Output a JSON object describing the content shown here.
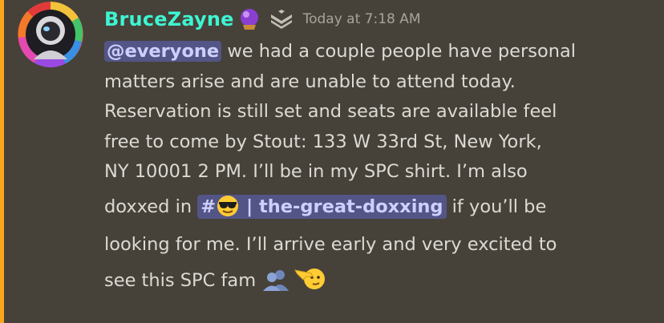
{
  "colors": {
    "background": "#46423a",
    "mention_accent": "#faa61a",
    "username": "#3ef5d2",
    "mention_bg": "#535586",
    "mention_text": "#cdd0ff",
    "body_text": "#dcdad4",
    "timestamp": "#a8a39a"
  },
  "author": {
    "name": "BruceZayne",
    "badge_icon": "crystal-ball-icon",
    "rank_icon": "chevron-rank-icon",
    "timestamp": "Today at 7:18 AM"
  },
  "message": {
    "mention": "@everyone",
    "line1_rest": " we had a couple people have personal",
    "line2": "matters arise and are unable to attend today.",
    "line3": "Reservation is still set and seats are available feel",
    "line4": "free to come by Stout: 133 W 33rd St, New York,",
    "line5": "NY 10001 2 PM. I’ll be in my SPC shirt. I’m also",
    "line6_pre": "doxxed in ",
    "channel_hash": "#",
    "channel_name": " | the-great-doxxing",
    "line6_post": " if you’ll be",
    "line7": "looking for me. I’ll arrive early and very excited to",
    "line8": "see this SPC fam ",
    "emojis": [
      "sunglasses-face-icon",
      "busts-in-silhouette-icon",
      "pointing-hand-face-icon"
    ]
  }
}
